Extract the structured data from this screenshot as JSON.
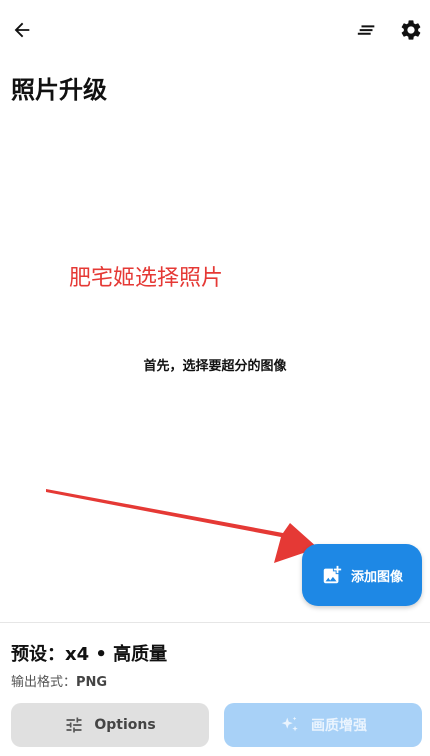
{
  "page": {
    "title": "照片升级",
    "annotation": "肥宅姬选择照片",
    "hint": "首先，选择要超分的图像"
  },
  "icons": {
    "back": "arrow-left-icon",
    "list": "list-icon",
    "settings": "gear-icon",
    "add_image": "add-photo-icon",
    "tune": "sliders-icon",
    "sparkle": "sparkle-icon"
  },
  "fab": {
    "label": "添加图像"
  },
  "preset": {
    "text": "预设：x4 • 高质量"
  },
  "output": {
    "label": "输出格式：",
    "value": "PNG"
  },
  "buttons": {
    "options": "Options",
    "enhance": "画质增强"
  },
  "colors": {
    "accent": "#1e88e5",
    "annotation": "#e53935",
    "disabled_accent": "#a8d1f7"
  }
}
